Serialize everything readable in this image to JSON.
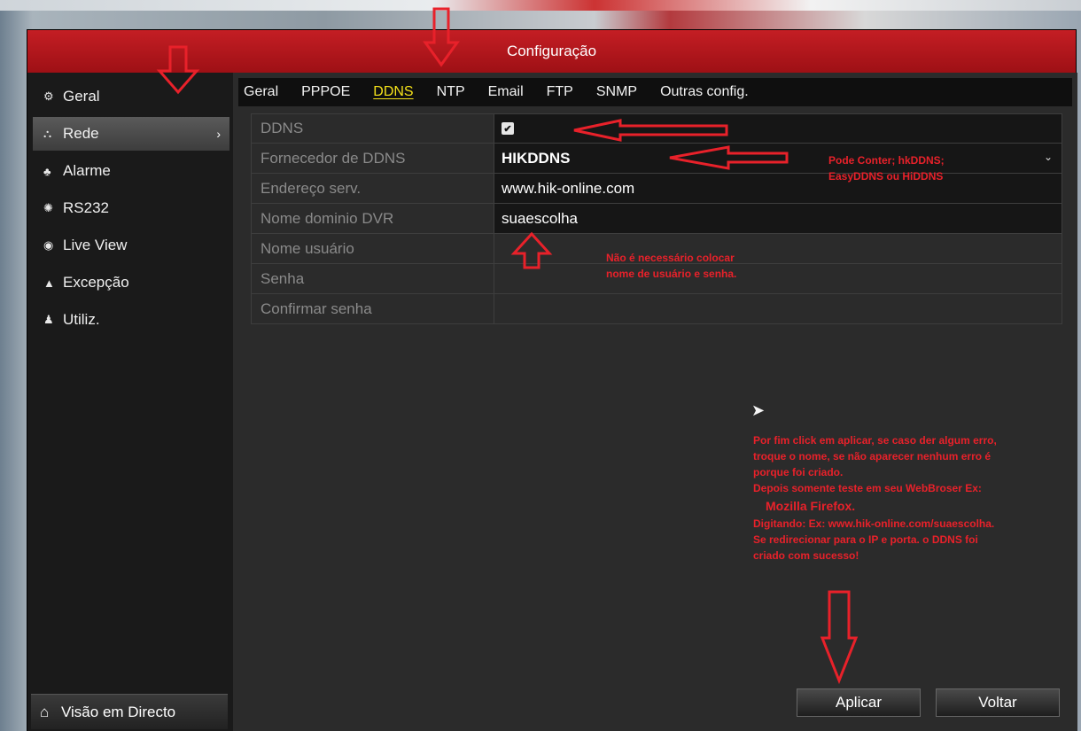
{
  "window": {
    "title": "Configuração"
  },
  "sidebar": {
    "items": [
      {
        "label": "Geral",
        "icon": "gear-icon"
      },
      {
        "label": "Rede",
        "icon": "network-icon",
        "active": true
      },
      {
        "label": "Alarme",
        "icon": "alarm-icon"
      },
      {
        "label": "RS232",
        "icon": "serial-icon"
      },
      {
        "label": "Live View",
        "icon": "eye-icon"
      },
      {
        "label": "Excepção",
        "icon": "warning-icon"
      },
      {
        "label": "Utiliz.",
        "icon": "users-icon"
      }
    ],
    "bottom": {
      "label": "Visão em Directo",
      "icon": "home-icon"
    }
  },
  "tabs": [
    "Geral",
    "PPPOE",
    "DDNS",
    "NTP",
    "Email",
    "FTP",
    "SNMP",
    "Outras config."
  ],
  "active_tab": "DDNS",
  "form": {
    "ddns": {
      "label": "DDNS",
      "checked": true
    },
    "provider": {
      "label": "Fornecedor de DDNS",
      "value": "HIKDDNS"
    },
    "server": {
      "label": "Endereço serv.",
      "value": "www.hik-online.com"
    },
    "domain": {
      "label": "Nome dominio DVR",
      "value": "suaescolha"
    },
    "username": {
      "label": "Nome usuário",
      "value": ""
    },
    "password": {
      "label": "Senha",
      "value": ""
    },
    "confirm": {
      "label": "Confirmar senha",
      "value": ""
    }
  },
  "buttons": {
    "apply": "Aplicar",
    "back": "Voltar"
  },
  "annotations": {
    "provider_note_1": "Pode Conter; hkDDNS;",
    "provider_note_2": "EasyDDNS ou HiDDNS",
    "user_note_1": "Não é necessário colocar",
    "user_note_2": "nome de usuário e senha.",
    "final_note": [
      "Por fim click em aplicar, se caso der algum erro,",
      "troque o nome, se não aparecer nenhum erro é",
      "porque foi criado.",
      "Depois somente teste em seu WebBroser Ex:",
      "Mozilla Firefox.",
      "Digitando: Ex: www.hik-online.com/suaescolha.",
      "Se redirecionar para o IP e porta. o DDNS foi",
      "criado com sucesso!"
    ]
  },
  "colors": {
    "title_red": "#c41e24",
    "active_tab": "#f5e21a",
    "annotation_red": "#e8212a"
  }
}
